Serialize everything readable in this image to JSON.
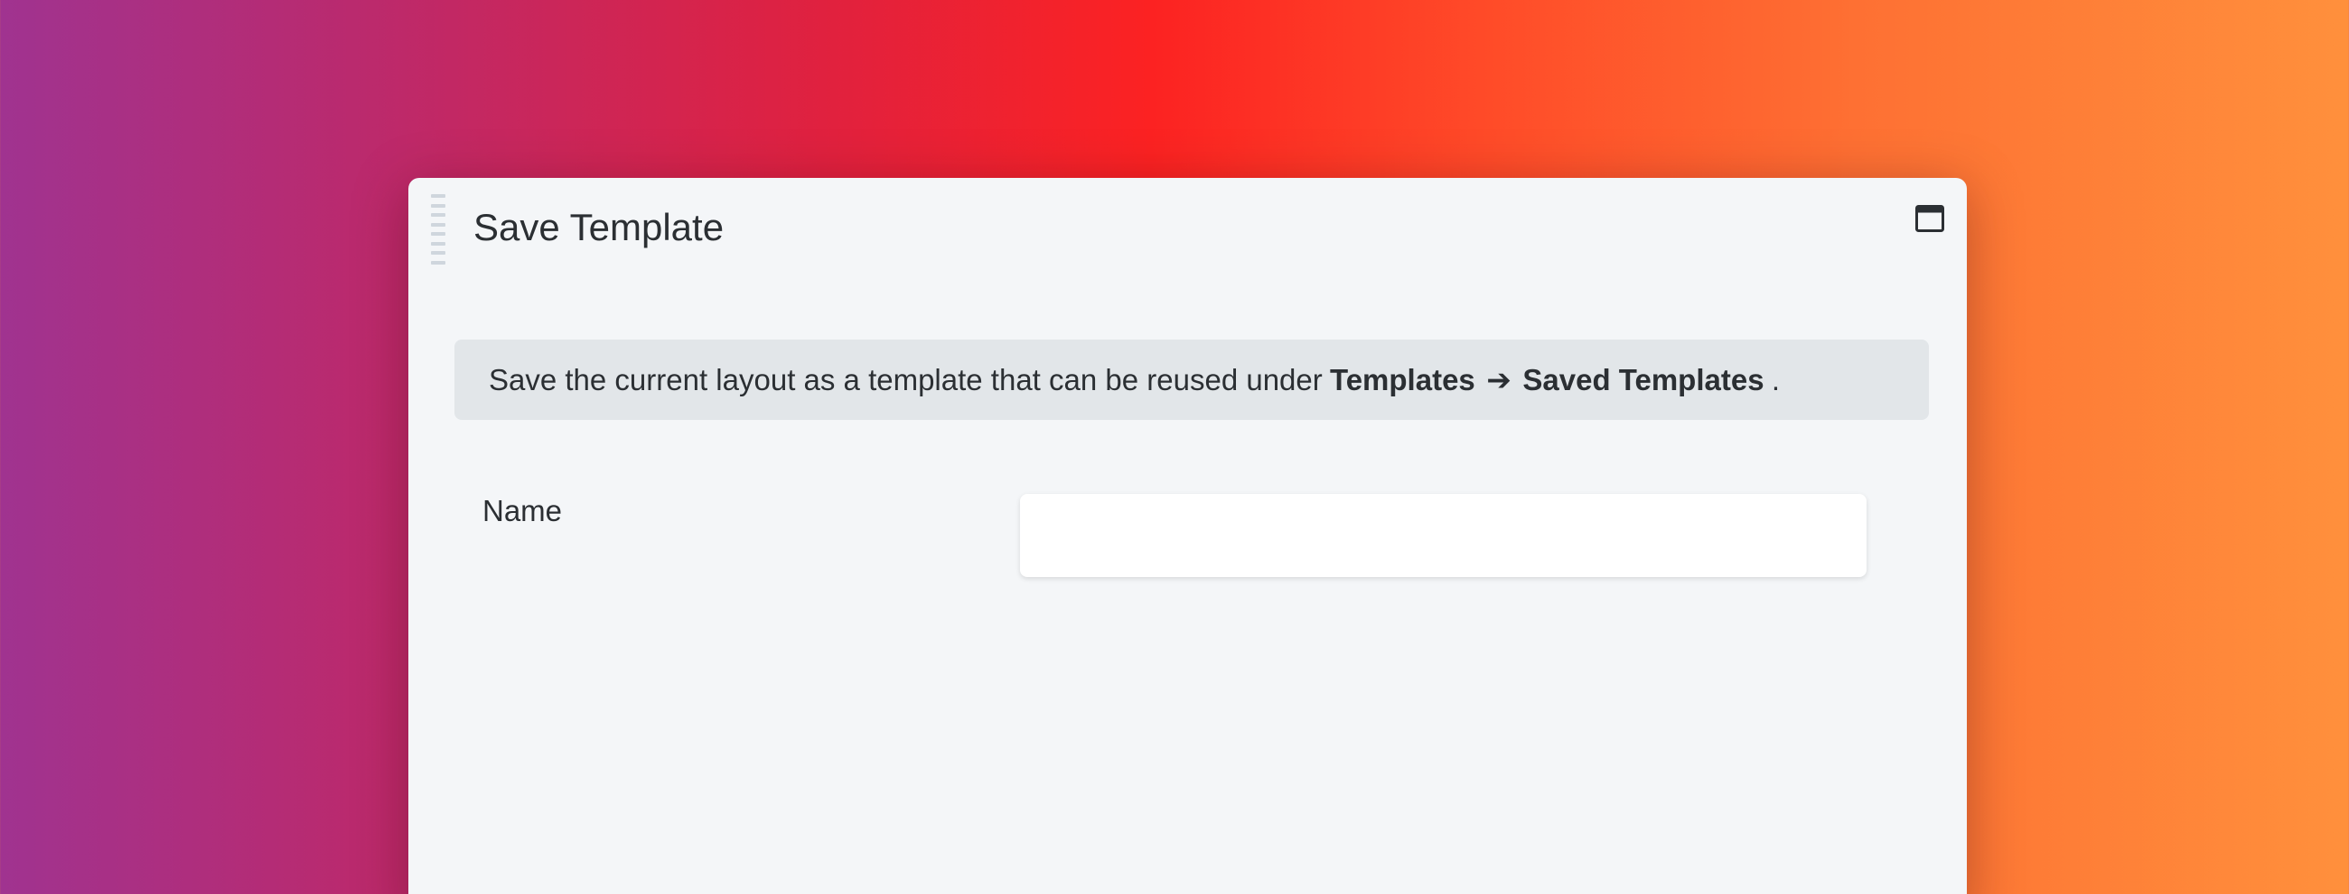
{
  "dialog": {
    "title": "Save Template",
    "window_icon": "window-maximize-icon",
    "drag_icon": "drag-handle-icon"
  },
  "info": {
    "text_before": "Save the current layout as a template that can be reused under",
    "path_first": "Templates",
    "arrow": "➔",
    "path_second": "Saved Templates",
    "text_after": "."
  },
  "form": {
    "name_label": "Name",
    "name_value": "",
    "name_placeholder": ""
  },
  "colors": {
    "dialog_background": "#f4f6f8",
    "info_background": "#e2e6e9",
    "text": "#2b2f33",
    "backdrop_start": "#a03390",
    "backdrop_mid": "#fc2222",
    "backdrop_end": "#ff903c"
  }
}
